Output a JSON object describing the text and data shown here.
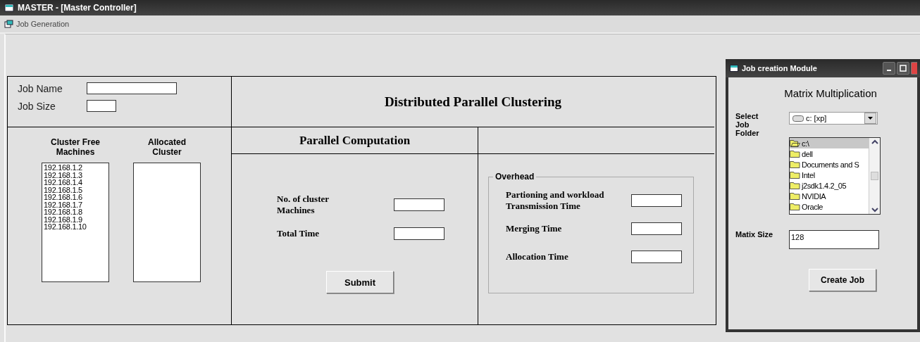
{
  "window": {
    "title": "MASTER - [Master Controller]"
  },
  "menu": [
    {
      "label": "Job Generation"
    }
  ],
  "job": {
    "name_label": "Job Name",
    "size_label": "Job Size"
  },
  "main_title": "Distributed Parallel Clustering",
  "lists": {
    "free_heading": "Cluster Free Machines",
    "allocated_heading": "Allocated Cluster",
    "free_machines": [
      "192.168.1.2",
      "192.168.1.3",
      "192.168.1.4",
      "192.168.1.5",
      "192.168.1.6",
      "192.168.1.7",
      "192.168.1.8",
      "192.168.1.9",
      "192.168.1.10"
    ]
  },
  "parallel": {
    "heading": "Parallel Computation",
    "machines_label": "No. of cluster Machines",
    "total_label": "Total  Time",
    "submit": "Submit"
  },
  "overhead": {
    "legend": "Overhead",
    "fields": [
      "Partioning and workload Transmission Time",
      "Merging Time",
      "Allocation Time"
    ]
  },
  "dialog": {
    "title": "Job creation Module",
    "heading": "Matrix Multiplication",
    "folder_label": "Select Job Folder",
    "drive": "c: [xp]",
    "folders": [
      {
        "label": "c:\\",
        "selected": true,
        "open": true
      },
      {
        "label": "dell",
        "selected": false,
        "open": false
      },
      {
        "label": "Documents and S",
        "selected": false,
        "open": false
      },
      {
        "label": "Intel",
        "selected": false,
        "open": false
      },
      {
        "label": "j2sdk1.4.2_05",
        "selected": false,
        "open": false
      },
      {
        "label": "NVIDIA",
        "selected": false,
        "open": false
      },
      {
        "label": "Oracle",
        "selected": false,
        "open": false
      }
    ],
    "size_label": "Matix Size",
    "size_value": "128",
    "button": "Create Job"
  }
}
